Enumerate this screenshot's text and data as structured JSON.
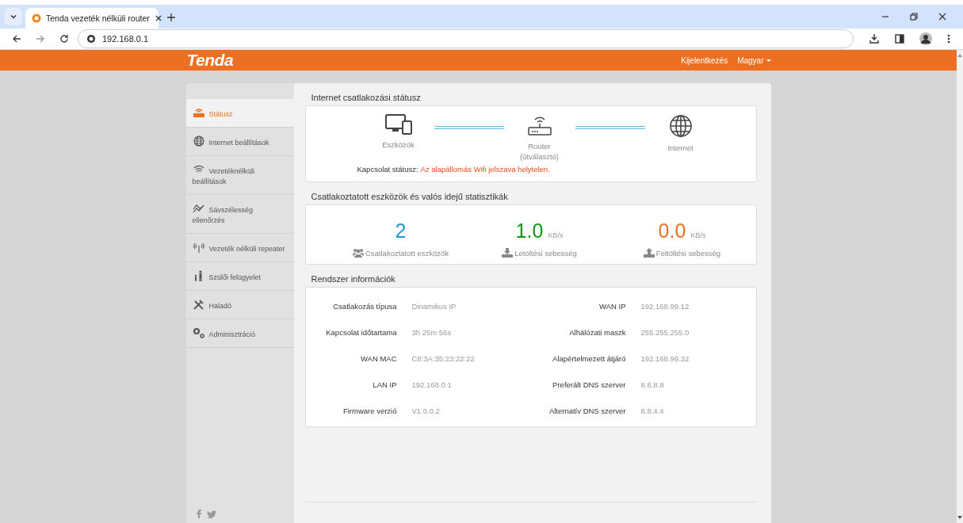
{
  "browser": {
    "tab_title": "Tenda vezeték nélküli router",
    "url": "192.168.0.1"
  },
  "header": {
    "logo": "Tenda",
    "logout": "Kijelentkezés",
    "language": "Magyar"
  },
  "sidebar": {
    "items": [
      {
        "label": "Státusz",
        "selected": true
      },
      {
        "label": "Internet beállítások",
        "selected": false
      },
      {
        "label": "Vezetéknélküli beállítások",
        "selected": false
      },
      {
        "label": "Sávszélesség ellenőrzés",
        "selected": false
      },
      {
        "label": "Vezeték nélküli repeater",
        "selected": false
      },
      {
        "label": "Szülői felügyelet",
        "selected": false
      },
      {
        "label": "Haladó",
        "selected": false
      },
      {
        "label": "Adminisztráció",
        "selected": false
      }
    ]
  },
  "connection": {
    "title": "Internet csatlakozási státusz",
    "nodes": [
      "Eszközök",
      "Router\n(útválasztó)",
      "Internet"
    ],
    "status_label": "Kapcsolat státusz:",
    "status_value": "Az alapállomás Wifi jelszava helytelen."
  },
  "stats": {
    "title": "Csatlakoztatott eszközök és valós idejű statisztikák",
    "items": [
      {
        "value": "2",
        "label": "Csatlakoztatott eszközök",
        "color": "#1e9ad6"
      },
      {
        "value": "1.0",
        "unit": "KB/s",
        "label": "Letöltési sebesség",
        "color": "#109618"
      },
      {
        "value": "0.0",
        "unit": "KB/s",
        "label": "Feltöltési sebesség",
        "color": "#ee6f22"
      }
    ]
  },
  "system": {
    "title": "Rendszer információk",
    "rows": [
      {
        "label": "Csatlakozás típusa",
        "value": "Dinamikus IP"
      },
      {
        "label": "WAN IP",
        "value": "192.168.99.12"
      },
      {
        "label": "Kapcsolat időtartama",
        "value": "3h 25m 56s"
      },
      {
        "label": "Alhálózati maszk",
        "value": "255.255.255.0"
      },
      {
        "label": "WAN MAC",
        "value": "C8:3A:35:23:22:22"
      },
      {
        "label": "Alapértelmezett átjáró",
        "value": "192.168.99.32"
      },
      {
        "label": "LAN IP",
        "value": "192.168.0.1"
      },
      {
        "label": "Preferált DNS szerver",
        "value": "8.8.8.8"
      },
      {
        "label": "Firmware verzió",
        "value": "V1.0.0.2"
      },
      {
        "label": "Alternatív DNS szerver",
        "value": "8.8.4.4"
      }
    ]
  }
}
